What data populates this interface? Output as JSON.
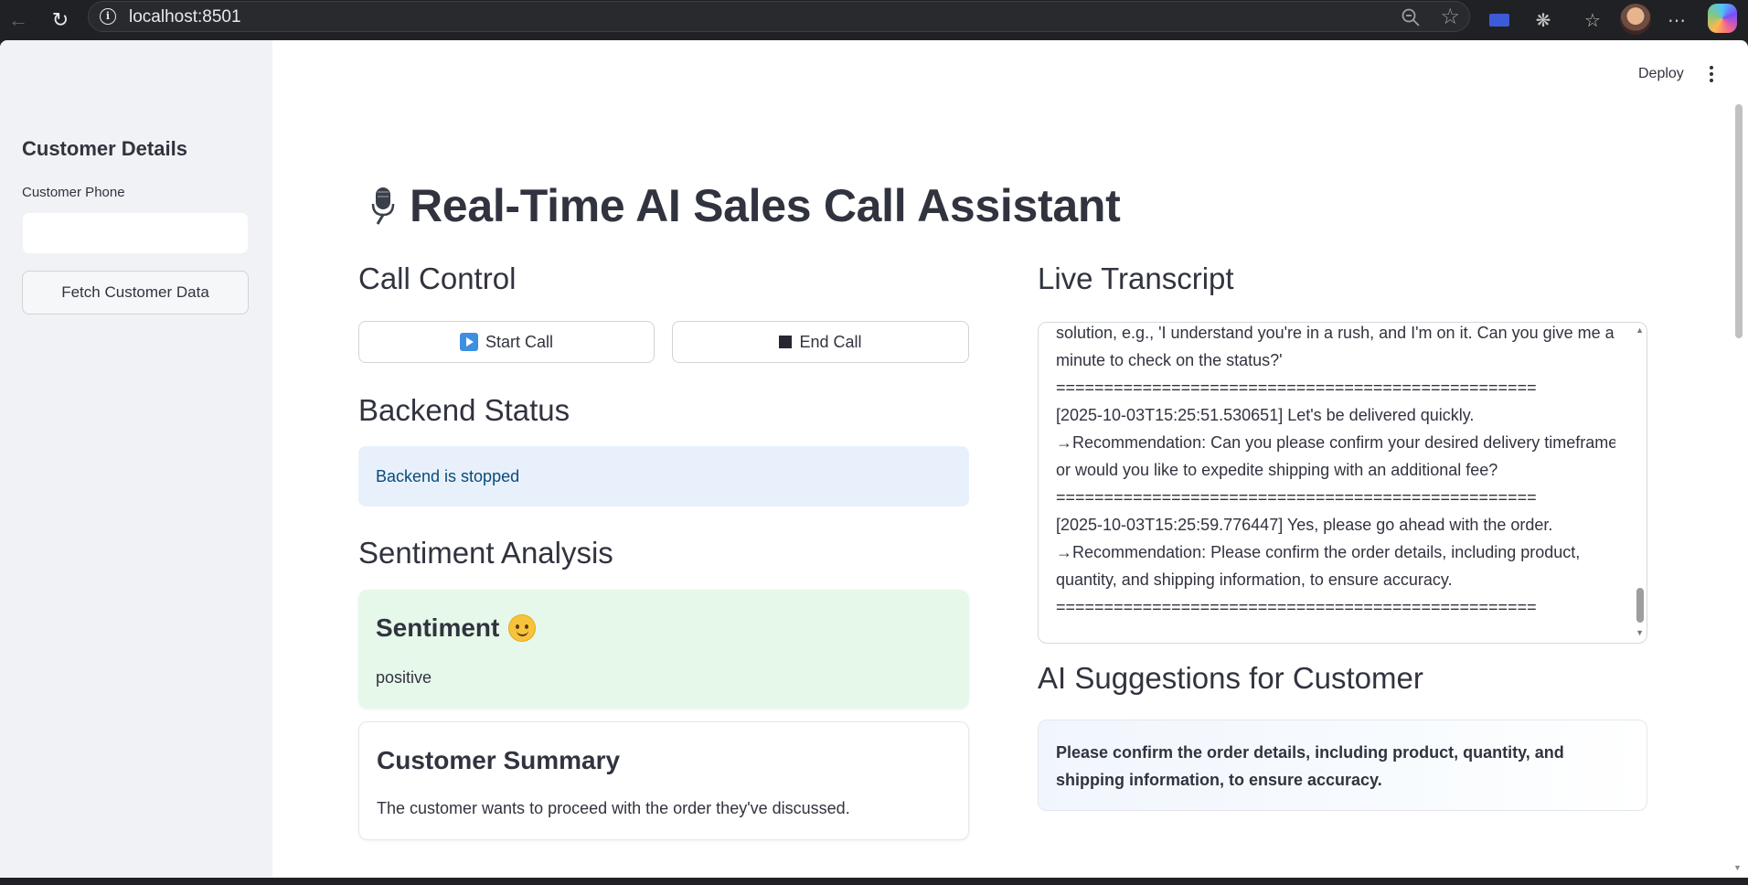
{
  "browser": {
    "url": "localhost:8501"
  },
  "sidebar": {
    "title": "Customer Details",
    "phone_label": "Customer Phone",
    "phone_value": "",
    "fetch_button": "Fetch Customer Data"
  },
  "header": {
    "deploy_label": "Deploy"
  },
  "main": {
    "title": "Real-Time AI Sales Call Assistant",
    "call_control": {
      "heading": "Call Control",
      "start_label": "Start Call",
      "end_label": "End Call"
    },
    "backend_status": {
      "heading": "Backend Status",
      "message": "Backend is stopped"
    },
    "sentiment": {
      "heading": "Sentiment Analysis",
      "card_title": "Sentiment",
      "value": "positive"
    },
    "summary": {
      "title": "Customer Summary",
      "text": "The customer wants to proceed with the order they've discussed."
    },
    "transcript": {
      "heading": "Live Transcript",
      "lines": [
        "solution, e.g., 'I understand you're in a rush, and I'm on it. Can you give me a",
        "minute to check on the status?'",
        "==================================================",
        "[2025-10-03T15:25:51.530651] Let's be delivered quickly.",
        "→Recommendation: Can you please confirm your desired delivery timeframe",
        "or would you like to expedite shipping with an additional fee?",
        "==================================================",
        "[2025-10-03T15:25:59.776447] Yes, please go ahead with the order.",
        "→Recommendation: Please confirm the order details, including product,",
        "quantity, and shipping information, to ensure accuracy.",
        "=================================================="
      ]
    },
    "suggestions": {
      "heading": "AI Suggestions for Customer",
      "text": "Please confirm the order details, including product, quantity, and shipping information, to ensure accuracy."
    }
  }
}
